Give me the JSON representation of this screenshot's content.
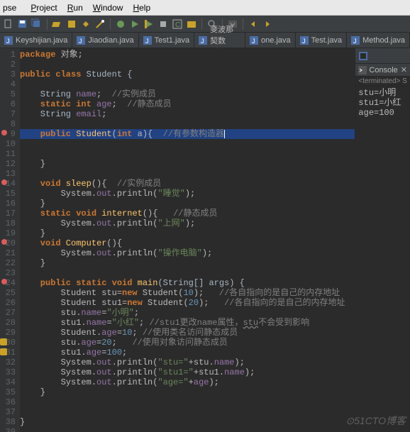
{
  "menu": {
    "project": "Project",
    "run": "Run",
    "window": "Window",
    "help": "Help"
  },
  "titleFragment": "pse",
  "tabs": [
    {
      "label": "Keyshijian.java"
    },
    {
      "label": "Jiaodian.java"
    },
    {
      "label": "Test1.java"
    },
    {
      "label": "斐波那契数列.java"
    },
    {
      "label": "one.java"
    },
    {
      "label": "Test.java"
    },
    {
      "label": "Method.java"
    }
  ],
  "console": {
    "tab": "Console",
    "terminated": "<terminated> S",
    "lines": [
      "stu=小明",
      "stu1=小红",
      "age=100"
    ]
  },
  "watermark": "⊙51CTO博客",
  "code": {
    "l1a": "package",
    "l1b": " 对象;",
    "l3a": "public class",
    "l3b": " Student {",
    "l5a": "    String",
    "l5b": " name",
    "l5c": ";  ",
    "l5d": "//实例成员",
    "l6a": "    static int",
    "l6b": " age",
    "l6c": ";  ",
    "l6d": "//静态成员",
    "l7a": "    String",
    "l7b": " email",
    "l7c": ";",
    "l9a": "    public",
    "l9b": " Student",
    "l9c": "(",
    "l9d": "int",
    "l9e": " a){  ",
    "l9f": "//有参数构造器",
    "l12a": "    }",
    "l14a": "    void",
    "l14b": " sleep",
    "l14c": "(){  ",
    "l14d": "//实例成员",
    "l15a": "        System.",
    "l15b": "out",
    "l15c": ".println(",
    "l15d": "\"睡觉\"",
    "l15e": ");",
    "l16a": "    }",
    "l17a": "    static void",
    "l17b": " internet",
    "l17c": "(){   ",
    "l17d": "//静态成员",
    "l18a": "        System.",
    "l18b": "out",
    "l18c": ".println(",
    "l18d": "\"上网\"",
    "l18e": ");",
    "l19a": "    }",
    "l20a": "    void",
    "l20b": " Computer",
    "l20c": "(){",
    "l21a": "        System.",
    "l21b": "out",
    "l21c": ".println(",
    "l21d": "\"操作电脑\"",
    "l21e": ");",
    "l22a": "    }",
    "l24a": "    public static void",
    "l24b": " main",
    "l24c": "(String[] args) {",
    "l25a": "        Student stu=",
    "l25b": "new",
    "l25c": " Student(",
    "l25d": "10",
    "l25e": ");   ",
    "l25f": "//各自指向的是自己的内存地址",
    "l26a": "        Student stu1=",
    "l26b": "new",
    "l26c": " Student(",
    "l26d": "20",
    "l26e": ");   ",
    "l26f": "//各自指向的是自己的内存地址",
    "l27a": "        stu.",
    "l27b": "name",
    "l27c": "=",
    "l27d": "\"小明\"",
    "l27e": ";",
    "l28a": "        stu1.",
    "l28b": "name",
    "l28c": "=",
    "l28d": "\"小红\"",
    "l28e": "; ",
    "l28f": "//stu1更改name属性，",
    "l28g": "stu",
    "l28h": "不会受到影响",
    "l29a": "        Student.",
    "l29b": "age",
    "l29c": "=",
    "l29d": "10",
    "l29e": "; ",
    "l29f": "//使用类名访问静态成员",
    "l30a": "        stu.",
    "l30b": "age",
    "l30c": "=",
    "l30d": "20",
    "l30e": ";   ",
    "l30f": "//使用对象访问静态成员",
    "l31a": "        stu1.",
    "l31b": "age",
    "l31c": "=",
    "l31d": "100",
    "l31e": ";",
    "l32a": "        System.",
    "l32b": "out",
    "l32c": ".println(",
    "l32d": "\"stu=\"",
    "l32e": "+stu.",
    "l32f": "name",
    "l32g": ");",
    "l33a": "        System.",
    "l33b": "out",
    "l33c": ".println(",
    "l33d": "\"stu1=\"",
    "l33e": "+stu1.",
    "l33f": "name",
    "l33g": ");",
    "l34a": "        System.",
    "l34b": "out",
    "l34c": ".println(",
    "l34d": "\"age=\"",
    "l34e": "+",
    "l34f": "age",
    "l34g": ");",
    "l35a": "    }",
    "l38a": "}"
  }
}
